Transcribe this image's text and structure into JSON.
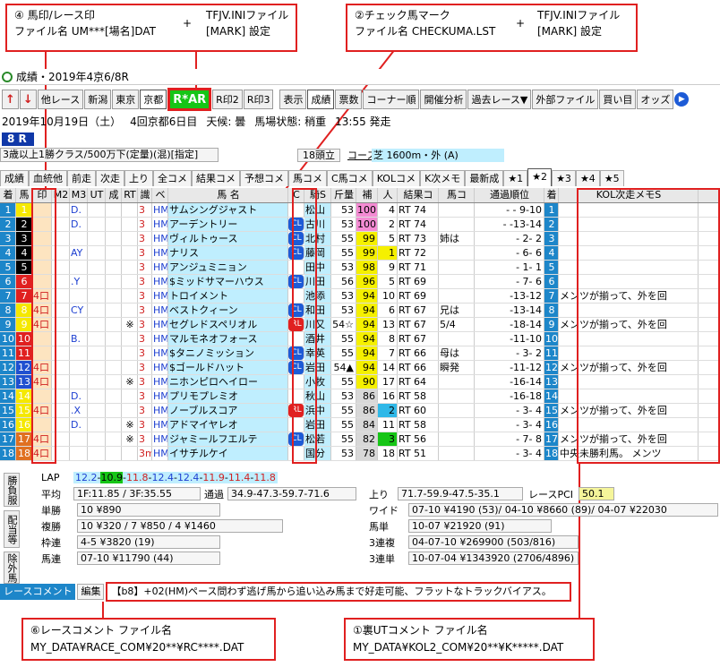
{
  "callouts": {
    "c4": {
      "line1": "④ 馬印/レース印",
      "line2": "ファイル名 UM***[場名]DAT",
      "plus": "+",
      "line3": "TFJV.INIファイル",
      "line4": "[MARK] 設定"
    },
    "c2": {
      "line1": "②チェック馬マーク",
      "line2": "ファイル名 CHECKUMA.LST",
      "plus": "+",
      "line3": "TFJV.INIファイル",
      "line4": "[MARK] 設定"
    },
    "c6": {
      "line1": "⑥レースコメント ファイル名",
      "line2": "MY_DATA¥RACE_COM¥20**¥RC****.DAT"
    },
    "c1": {
      "line1": "①裏UTコメント ファイル名",
      "line2": "MY_DATA¥KOL2_COM¥20**¥K*****.DAT"
    }
  },
  "window": {
    "title": "成績・2019年4京6/8R"
  },
  "toolbar": {
    "other_race": "他レース",
    "niigata": "新潟",
    "tokyo": "東京",
    "kyoto": "京都",
    "rar": "R*AR",
    "r2": "R印2",
    "r3": "R印3",
    "display": "表示",
    "seiseki": "成績",
    "hyosu": "票数",
    "corner": "コーナー順",
    "kaisai": "開催分析",
    "past": "過去レース▼",
    "external": "外部ファイル",
    "kaime": "買い目",
    "odds": "オッズ"
  },
  "info": {
    "date": "2019年10月19日（土）",
    "venue": "4回京都6日目",
    "weather_label": "天候:",
    "weather": "曇",
    "track_label": "馬場状態:",
    "track": "稍重",
    "start": "13:55 発走"
  },
  "race": {
    "number": "8 R",
    "conditions": "3歳以上1勝クラス/500万下(定量)(混)[指定]",
    "field": "18頭立",
    "course_label": "コース図",
    "course": "芝 1600m・外 (A)"
  },
  "tabs": [
    "成績",
    "血統他",
    "前走",
    "次走",
    "上り",
    "全コメ",
    "結果コメ",
    "予想コメ",
    "馬コメ",
    "C馬コメ",
    "KOLコメ",
    "K次メモ",
    "最新成",
    "★1",
    "★2",
    "★3",
    "★4",
    "★5"
  ],
  "columns": [
    "着",
    "馬",
    "印",
    "M2",
    "M3",
    "UT",
    "成",
    "RT",
    "識",
    "ベ",
    "馬 名",
    "C",
    "騎S",
    "斤量",
    "補",
    "人",
    "結果コ",
    "馬コ",
    "通過順位",
    "着",
    "KOL次走メモS"
  ],
  "rows": [
    {
      "f": "1",
      "u": "1",
      "uc": "#fff",
      "ubg": "#f5e800",
      "m1": "",
      "m3": "D.",
      "x": "",
      "k": "3",
      "b": "HM",
      "name": "サムシングジャスト",
      "c": "",
      "j": "松山",
      "w": "53",
      "h": "100",
      "hc": "#f48bd3",
      "p": "4",
      "pc": "",
      "rt": "RT 74",
      "uk": "",
      "pass": "- - 9-10",
      "f2": "1",
      "memo": ""
    },
    {
      "f": "2",
      "u": "2",
      "uc": "#fff",
      "ubg": "#000",
      "m1": "",
      "m3": "D.",
      "x": "",
      "k": "3",
      "b": "HM",
      "name": "アーデントリー",
      "c": "CL",
      "j": "古川",
      "w": "53",
      "h": "100",
      "hc": "#f48bd3",
      "p": "2",
      "pc": "",
      "rt": "RT 74",
      "uk": "",
      "pass": "- -13-14",
      "f2": "2",
      "memo": ""
    },
    {
      "f": "3",
      "u": "3",
      "uc": "#fff",
      "ubg": "#000",
      "m1": "",
      "m3": "",
      "x": "",
      "k": "3",
      "b": "HM",
      "name": "ヴィルトゥース",
      "c": "CL",
      "j": "北村",
      "w": "55",
      "h": "99",
      "hc": "#f5f000",
      "p": "5",
      "pc": "",
      "rt": "RT 73",
      "uk": "姉は",
      "pass": "- 2- 2",
      "f2": "3",
      "memo": ""
    },
    {
      "f": "4",
      "u": "4",
      "uc": "#fff",
      "ubg": "#000",
      "m1": "",
      "m3": "AY",
      "x": "",
      "k": "3",
      "b": "HM",
      "name": "ナリス",
      "c": "CL",
      "j": "藤岡",
      "w": "55",
      "h": "99",
      "hc": "#f5f000",
      "p": "1",
      "pc": "#f5f000",
      "rt": "RT 72",
      "uk": "",
      "pass": "- 6- 6",
      "f2": "4",
      "memo": ""
    },
    {
      "f": "5",
      "u": "5",
      "uc": "#fff",
      "ubg": "#000",
      "m1": "",
      "m3": "",
      "x": "",
      "k": "3",
      "b": "HM",
      "name": "アンジュミニョン",
      "c": "",
      "j": "田中",
      "w": "53",
      "h": "98",
      "hc": "#f5f000",
      "p": "9",
      "pc": "",
      "rt": "RT 71",
      "uk": "",
      "pass": "- 1- 1",
      "f2": "5",
      "memo": ""
    },
    {
      "f": "6",
      "u": "6",
      "uc": "#fff",
      "ubg": "#e02020",
      "m1": "",
      "m3": ".Y",
      "x": "",
      "k": "3",
      "b": "HM",
      "name": "$ミッドサマーハウス",
      "c": "CL",
      "j": "川田",
      "w": "56",
      "h": "96",
      "hc": "#f5f000",
      "p": "5",
      "pc": "",
      "rt": "RT 69",
      "uk": "",
      "pass": "- 7- 6",
      "f2": "6",
      "memo": ""
    },
    {
      "f": "7",
      "u": "7",
      "uc": "#fff",
      "ubg": "#e02020",
      "m1": "4口",
      "m3": "",
      "x": "",
      "k": "3",
      "b": "HM",
      "name": "トロイメント",
      "c": "",
      "j": "池添",
      "w": "53",
      "h": "94",
      "hc": "#f5f000",
      "p": "10",
      "pc": "",
      "rt": "RT 69",
      "uk": "",
      "pass": "-13-12",
      "f2": "7",
      "memo": "メンツが揃って、外を回"
    },
    {
      "f": "8",
      "u": "8",
      "uc": "#fff",
      "ubg": "#f5e800",
      "m1": "4口",
      "m3": "CY",
      "x": "",
      "k": "3",
      "b": "HM",
      "name": "ベストクィーン",
      "c": "CL",
      "j": "和田",
      "w": "53",
      "h": "94",
      "hc": "#f5f000",
      "p": "6",
      "pc": "",
      "rt": "RT 67",
      "uk": "兄は",
      "pass": "-13-14",
      "f2": "8",
      "memo": ""
    },
    {
      "f": "9",
      "u": "9",
      "uc": "#fff",
      "ubg": "#f5e800",
      "m1": "4口",
      "m3": "",
      "x": "※",
      "k": "3",
      "b": "HM",
      "name": "セグレドスペリオル",
      "c": "RL",
      "j": "川又",
      "w": "54☆",
      "h": "94",
      "hc": "#f5f000",
      "p": "13",
      "pc": "",
      "rt": "RT 67",
      "uk": "5/4",
      "pass": "-18-14",
      "f2": "9",
      "memo": "メンツが揃って、外を回"
    },
    {
      "f": "10",
      "u": "10",
      "uc": "#fff",
      "ubg": "#e02020",
      "m1": "",
      "m3": "B.",
      "x": "",
      "k": "3",
      "b": "HM",
      "name": "マルモネオフォース",
      "c": "",
      "j": "酒井",
      "w": "55",
      "h": "94",
      "hc": "#f5f000",
      "p": "8",
      "pc": "",
      "rt": "RT 67",
      "uk": "",
      "pass": "-11-10",
      "f2": "10",
      "memo": ""
    },
    {
      "f": "11",
      "u": "11",
      "uc": "#fff",
      "ubg": "#e02020",
      "m1": "",
      "m3": "",
      "x": "",
      "k": "3",
      "b": "HM",
      "name": "$タニノミッション",
      "c": "CL",
      "j": "幸英",
      "w": "55",
      "h": "94",
      "hc": "#f5f000",
      "p": "7",
      "pc": "",
      "rt": "RT 66",
      "uk": "母は",
      "pass": "- 3- 2",
      "f2": "11",
      "memo": ""
    },
    {
      "f": "12",
      "u": "12",
      "uc": "#fff",
      "ubg": "#2050d0",
      "m1": "4口",
      "m3": "",
      "x": "",
      "k": "3",
      "b": "HM",
      "name": "$ゴールドハット",
      "c": "CL",
      "j": "岩田",
      "w": "54▲",
      "h": "94",
      "hc": "#f5f000",
      "p": "14",
      "pc": "",
      "rt": "RT 66",
      "uk": "瞬発",
      "pass": "-11-12",
      "f2": "12",
      "memo": "メンツが揃って、外を回"
    },
    {
      "f": "13",
      "u": "13",
      "uc": "#fff",
      "ubg": "#2050d0",
      "m1": "4口",
      "m3": "",
      "x": "※",
      "k": "3",
      "b": "HM",
      "name": "ニホンピロヘイロー",
      "c": "",
      "j": "小牧",
      "w": "55",
      "h": "90",
      "hc": "#f5f000",
      "p": "17",
      "pc": "",
      "rt": "RT 64",
      "uk": "",
      "pass": "-16-14",
      "f2": "13",
      "memo": ""
    },
    {
      "f": "14",
      "u": "14",
      "uc": "#fff",
      "ubg": "#f5e800",
      "m1": "",
      "m3": "D.",
      "x": "",
      "k": "3",
      "b": "HM",
      "name": "プリモプレミオ",
      "c": "",
      "j": "秋山",
      "w": "53",
      "h": "86",
      "hc": "#d8d8d8",
      "p": "16",
      "pc": "",
      "rt": "RT 58",
      "uk": "",
      "pass": "-16-18",
      "f2": "14",
      "memo": ""
    },
    {
      "f": "15",
      "u": "15",
      "uc": "#fff",
      "ubg": "#f5e800",
      "m1": "4口",
      "m3": ".X",
      "x": "",
      "k": "3",
      "b": "HM",
      "name": "ノーブルスコア",
      "c": "RL",
      "j": "浜中",
      "w": "55",
      "h": "86",
      "hc": "#d8d8d8",
      "p": "2",
      "pc": "#2fb8e8",
      "rt": "RT 60",
      "uk": "",
      "pass": "- 3- 4",
      "f2": "15",
      "memo": "メンツが揃って、外を回"
    },
    {
      "f": "16",
      "u": "16",
      "uc": "#fff",
      "ubg": "#f5e800",
      "m1": "",
      "m3": "D.",
      "x": "※",
      "k": "3",
      "b": "HM",
      "name": "アドマイヤレオ",
      "c": "",
      "j": "岩田",
      "w": "55",
      "h": "84",
      "hc": "#d8d8d8",
      "p": "11",
      "pc": "",
      "rt": "RT 58",
      "uk": "",
      "pass": "- 3- 4",
      "f2": "16",
      "memo": ""
    },
    {
      "f": "17",
      "u": "17",
      "uc": "#fff",
      "ubg": "#e07020",
      "m1": "4口",
      "m3": "",
      "x": "※",
      "k": "3",
      "b": "HM",
      "name": "ジャミールフエルテ",
      "c": "CL",
      "j": "松若",
      "w": "55",
      "h": "82",
      "hc": "#d8d8d8",
      "p": "3",
      "pc": "#16c516",
      "rt": "RT 56",
      "uk": "",
      "pass": "- 7- 8",
      "f2": "17",
      "memo": "メンツが揃って、外を回"
    },
    {
      "f": "18",
      "u": "18",
      "uc": "#fff",
      "ubg": "#e07020",
      "m1": "4口",
      "m3": "",
      "x": "",
      "k": "3m",
      "b": "HM",
      "name": "イサチルケイ",
      "c": "",
      "j": "国分",
      "w": "53",
      "h": "78",
      "hc": "#d8d8d8",
      "p": "18",
      "pc": "",
      "rt": "RT 51",
      "uk": "",
      "pass": "- 3- 4",
      "f2": "18",
      "memo": "中央未勝利馬。 メンツ"
    }
  ],
  "lap": {
    "label": "LAP",
    "laps": [
      "12.2",
      "10.9",
      "11.8",
      "12.4",
      "12.4",
      "11.9",
      "11.4",
      "11.8"
    ],
    "avg_label": "平均",
    "avg": "1F:11.85 / 3F:35.55",
    "pass_label": "通過",
    "pass": "34.9-47.3-59.7-71.6",
    "agari_label": "上り",
    "agari": "71.7-59.9-47.5-35.1",
    "pci_label": "レースPCI",
    "pci": "50.1"
  },
  "payouts": {
    "side1": "勝負服",
    "side2": "配当等",
    "side3": "除外馬",
    "tansho_label": "単勝",
    "tansho": "10 ¥890",
    "fukusho_label": "複勝",
    "fukusho": "10 ¥320 / 7 ¥850 / 4 ¥1460",
    "wakuren_label": "枠連",
    "wakuren": "4-5 ¥3820 (19)",
    "umaren_label": "馬連",
    "umaren": "07-10 ¥11790 (44)",
    "wide_label": "ワイド",
    "wide": "07-10 ¥4190 (53)/ 04-10 ¥8660 (89)/ 04-07 ¥22030",
    "umatan_label": "馬単",
    "umatan": "10-07 ¥21920 (91)",
    "trio_label": "3連複",
    "trio": "04-07-10 ¥269900 (503/816)",
    "trifecta_label": "3連単",
    "trifecta": "10-07-04 ¥1343920 (2706/4896)"
  },
  "comment": {
    "tab": "レースコメント",
    "edit": "編集",
    "text": "【b8】+02(HM)ペース問わず逃げ馬から追い込み馬まで好走可能、フラットなトラックバイアス。"
  }
}
